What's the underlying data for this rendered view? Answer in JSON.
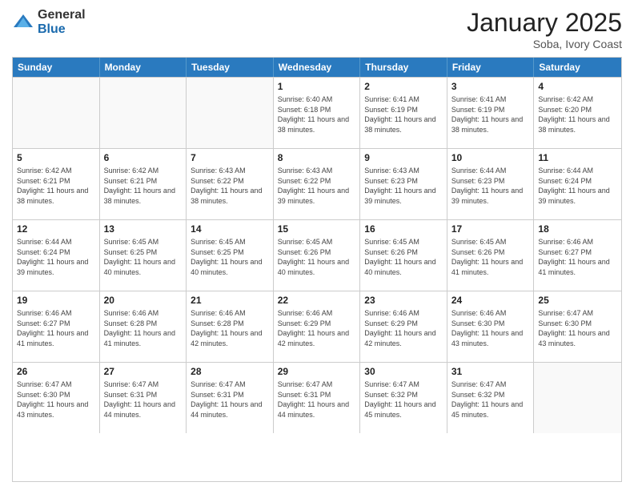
{
  "header": {
    "logo_general": "General",
    "logo_blue": "Blue",
    "month_title": "January 2025",
    "subtitle": "Soba, Ivory Coast"
  },
  "days_of_week": [
    "Sunday",
    "Monday",
    "Tuesday",
    "Wednesday",
    "Thursday",
    "Friday",
    "Saturday"
  ],
  "weeks": [
    [
      {
        "day": "",
        "empty": true
      },
      {
        "day": "",
        "empty": true
      },
      {
        "day": "",
        "empty": true
      },
      {
        "day": "1",
        "sunrise": "6:40 AM",
        "sunset": "6:18 PM",
        "daylight": "11 hours and 38 minutes."
      },
      {
        "day": "2",
        "sunrise": "6:41 AM",
        "sunset": "6:19 PM",
        "daylight": "11 hours and 38 minutes."
      },
      {
        "day": "3",
        "sunrise": "6:41 AM",
        "sunset": "6:19 PM",
        "daylight": "11 hours and 38 minutes."
      },
      {
        "day": "4",
        "sunrise": "6:42 AM",
        "sunset": "6:20 PM",
        "daylight": "11 hours and 38 minutes."
      }
    ],
    [
      {
        "day": "5",
        "sunrise": "6:42 AM",
        "sunset": "6:21 PM",
        "daylight": "11 hours and 38 minutes."
      },
      {
        "day": "6",
        "sunrise": "6:42 AM",
        "sunset": "6:21 PM",
        "daylight": "11 hours and 38 minutes."
      },
      {
        "day": "7",
        "sunrise": "6:43 AM",
        "sunset": "6:22 PM",
        "daylight": "11 hours and 38 minutes."
      },
      {
        "day": "8",
        "sunrise": "6:43 AM",
        "sunset": "6:22 PM",
        "daylight": "11 hours and 39 minutes."
      },
      {
        "day": "9",
        "sunrise": "6:43 AM",
        "sunset": "6:23 PM",
        "daylight": "11 hours and 39 minutes."
      },
      {
        "day": "10",
        "sunrise": "6:44 AM",
        "sunset": "6:23 PM",
        "daylight": "11 hours and 39 minutes."
      },
      {
        "day": "11",
        "sunrise": "6:44 AM",
        "sunset": "6:24 PM",
        "daylight": "11 hours and 39 minutes."
      }
    ],
    [
      {
        "day": "12",
        "sunrise": "6:44 AM",
        "sunset": "6:24 PM",
        "daylight": "11 hours and 39 minutes."
      },
      {
        "day": "13",
        "sunrise": "6:45 AM",
        "sunset": "6:25 PM",
        "daylight": "11 hours and 40 minutes."
      },
      {
        "day": "14",
        "sunrise": "6:45 AM",
        "sunset": "6:25 PM",
        "daylight": "11 hours and 40 minutes."
      },
      {
        "day": "15",
        "sunrise": "6:45 AM",
        "sunset": "6:26 PM",
        "daylight": "11 hours and 40 minutes."
      },
      {
        "day": "16",
        "sunrise": "6:45 AM",
        "sunset": "6:26 PM",
        "daylight": "11 hours and 40 minutes."
      },
      {
        "day": "17",
        "sunrise": "6:45 AM",
        "sunset": "6:26 PM",
        "daylight": "11 hours and 41 minutes."
      },
      {
        "day": "18",
        "sunrise": "6:46 AM",
        "sunset": "6:27 PM",
        "daylight": "11 hours and 41 minutes."
      }
    ],
    [
      {
        "day": "19",
        "sunrise": "6:46 AM",
        "sunset": "6:27 PM",
        "daylight": "11 hours and 41 minutes."
      },
      {
        "day": "20",
        "sunrise": "6:46 AM",
        "sunset": "6:28 PM",
        "daylight": "11 hours and 41 minutes."
      },
      {
        "day": "21",
        "sunrise": "6:46 AM",
        "sunset": "6:28 PM",
        "daylight": "11 hours and 42 minutes."
      },
      {
        "day": "22",
        "sunrise": "6:46 AM",
        "sunset": "6:29 PM",
        "daylight": "11 hours and 42 minutes."
      },
      {
        "day": "23",
        "sunrise": "6:46 AM",
        "sunset": "6:29 PM",
        "daylight": "11 hours and 42 minutes."
      },
      {
        "day": "24",
        "sunrise": "6:46 AM",
        "sunset": "6:30 PM",
        "daylight": "11 hours and 43 minutes."
      },
      {
        "day": "25",
        "sunrise": "6:47 AM",
        "sunset": "6:30 PM",
        "daylight": "11 hours and 43 minutes."
      }
    ],
    [
      {
        "day": "26",
        "sunrise": "6:47 AM",
        "sunset": "6:30 PM",
        "daylight": "11 hours and 43 minutes."
      },
      {
        "day": "27",
        "sunrise": "6:47 AM",
        "sunset": "6:31 PM",
        "daylight": "11 hours and 44 minutes."
      },
      {
        "day": "28",
        "sunrise": "6:47 AM",
        "sunset": "6:31 PM",
        "daylight": "11 hours and 44 minutes."
      },
      {
        "day": "29",
        "sunrise": "6:47 AM",
        "sunset": "6:31 PM",
        "daylight": "11 hours and 44 minutes."
      },
      {
        "day": "30",
        "sunrise": "6:47 AM",
        "sunset": "6:32 PM",
        "daylight": "11 hours and 45 minutes."
      },
      {
        "day": "31",
        "sunrise": "6:47 AM",
        "sunset": "6:32 PM",
        "daylight": "11 hours and 45 minutes."
      },
      {
        "day": "",
        "empty": true
      }
    ]
  ]
}
